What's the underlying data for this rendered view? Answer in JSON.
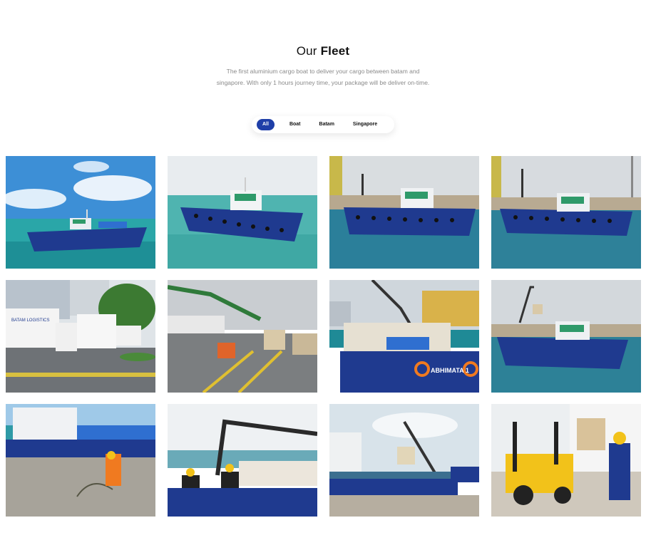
{
  "section": {
    "title_light": "Our ",
    "title_bold": "Fleet",
    "subtitle_line1": "The first aluminium cargo boat to deliver your cargo between batam and",
    "subtitle_line2": "singapore. With only 1 hours journey time, your package will be deliver on-time."
  },
  "filters": {
    "active": "All",
    "items": [
      {
        "label": "All"
      },
      {
        "label": "Boat"
      },
      {
        "label": "Batam"
      },
      {
        "label": "Singapore"
      }
    ]
  },
  "gallery": {
    "boat_names": {
      "tile_3": "ABHIMATA 1"
    },
    "truck_text": "BATAM LOGISTICS",
    "colors": {
      "hull_blue": "#1f3a8f",
      "cabin_green": "#2f9a6a",
      "sea": "#4fb4b0",
      "forklift_yellow": "#f2c21a",
      "worker_orange": "#f07a20"
    }
  }
}
